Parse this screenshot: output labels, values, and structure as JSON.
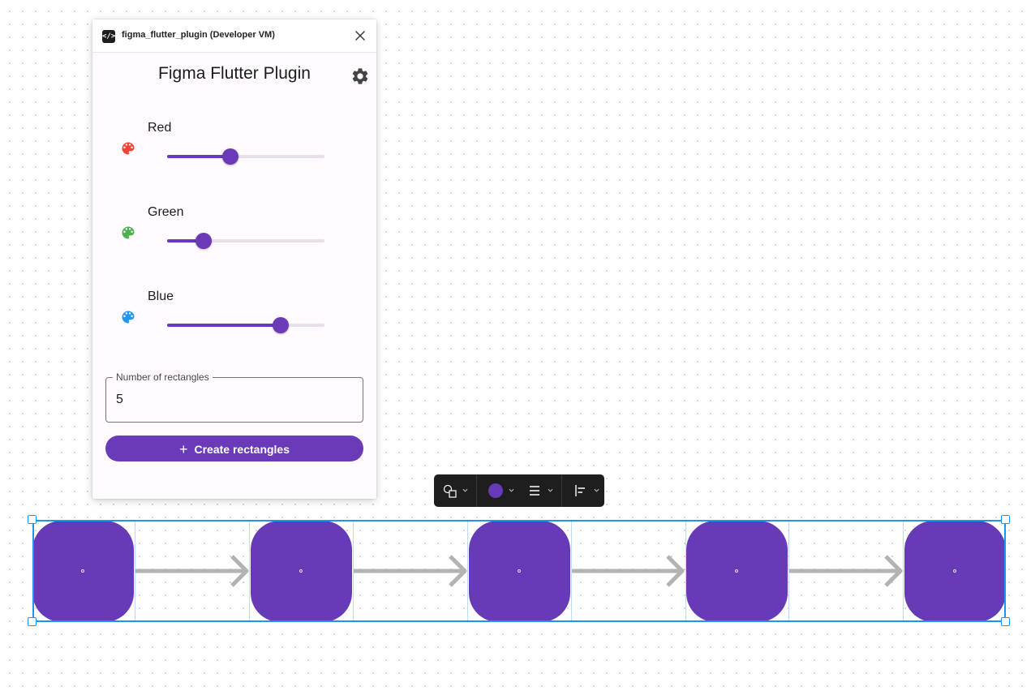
{
  "plugin_window": {
    "title": "figma_flutter_plugin (Developer VM)",
    "app_icon": "code-icon",
    "close_icon": "close-icon"
  },
  "app": {
    "title": "Figma Flutter Plugin",
    "settings_icon": "gear-icon"
  },
  "sliders": [
    {
      "label": "Red",
      "icon": "palette-icon",
      "icon_color": "#f44336",
      "value_fraction": 0.4
    },
    {
      "label": "Green",
      "icon": "palette-icon",
      "icon_color": "#4caf50",
      "value_fraction": 0.23
    },
    {
      "label": "Blue",
      "icon": "palette-icon",
      "icon_color": "#2196f3",
      "value_fraction": 0.72
    }
  ],
  "rect_count_field": {
    "label": "Number of rectangles",
    "value": "5"
  },
  "create_button": {
    "icon": "plus-icon",
    "label": "Create rectangles"
  },
  "toolbar": {
    "items": [
      "shape-tool-icon",
      "fill-color-swatch",
      "stroke-icon",
      "align-icon"
    ],
    "fill_color": "#673ab7"
  },
  "canvas": {
    "rectangle_count": 5,
    "rectangle_color": "#673ab7",
    "connector_color": "#b3b3b3",
    "selection_color": "#1c95f0"
  },
  "colors": {
    "accent": "#6a3ab8",
    "background": "#fffbfe"
  }
}
